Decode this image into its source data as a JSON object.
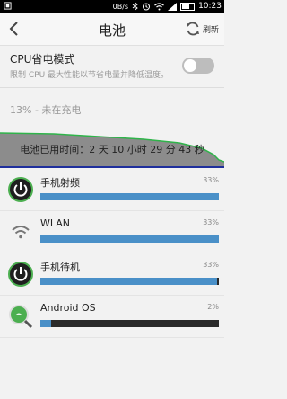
{
  "status_bar": {
    "network_speed": "0B/s",
    "time": "10:23"
  },
  "header": {
    "title": "电池",
    "refresh_label": "刷新"
  },
  "power_saving": {
    "title": "CPU省电模式",
    "description": "限制 CPU 最大性能以节省电量并降低温度。",
    "enabled": false
  },
  "battery": {
    "status": "13% - 未在充电",
    "usage_time": "电池已用时间：2 天 10 小时 29 分 43 秒"
  },
  "usage_items": [
    {
      "name": "手机射频",
      "percent": "33%",
      "fill": 1.0,
      "icon": "green-power-icon"
    },
    {
      "name": "WLAN",
      "percent": "33%",
      "fill": 1.0,
      "icon": "wifi-icon"
    },
    {
      "name": "手机待机",
      "percent": "33%",
      "fill": 0.99,
      "icon": "green-power-icon"
    },
    {
      "name": "Android OS",
      "percent": "2%",
      "fill": 0.06,
      "icon": "android-magnifier-icon"
    }
  ],
  "colors": {
    "bar_fill": "#4a90c8",
    "bar_track": "#2a2a2a",
    "graph_line": "#2fb44a",
    "graph_fill": "#8c8c8c"
  }
}
